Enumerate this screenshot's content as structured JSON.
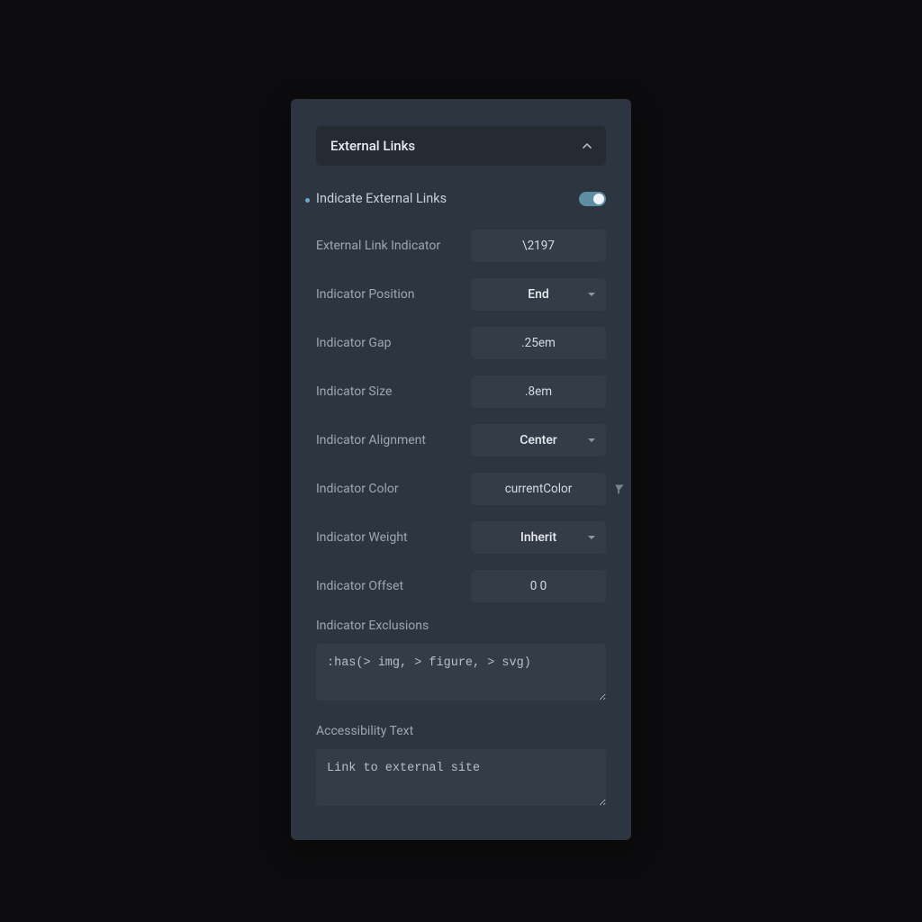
{
  "section": {
    "title": "External Links"
  },
  "toggle": {
    "label": "Indicate External Links",
    "on": true
  },
  "fields": {
    "indicator": {
      "label": "External Link Indicator",
      "value": "\\2197"
    },
    "position": {
      "label": "Indicator Position",
      "value": "End"
    },
    "gap": {
      "label": "Indicator Gap",
      "value": ".25em"
    },
    "size": {
      "label": "Indicator Size",
      "value": ".8em"
    },
    "align": {
      "label": "Indicator Alignment",
      "value": "Center"
    },
    "color": {
      "label": "Indicator Color",
      "value": "currentColor"
    },
    "weight": {
      "label": "Indicator Weight",
      "value": "Inherit"
    },
    "offset": {
      "label": "Indicator Offset",
      "value": "0 0"
    }
  },
  "exclusions": {
    "label": "Indicator Exclusions",
    "value": ":has(> img, > figure, > svg)"
  },
  "a11y": {
    "label": "Accessibility Text",
    "value": "Link to external site"
  }
}
